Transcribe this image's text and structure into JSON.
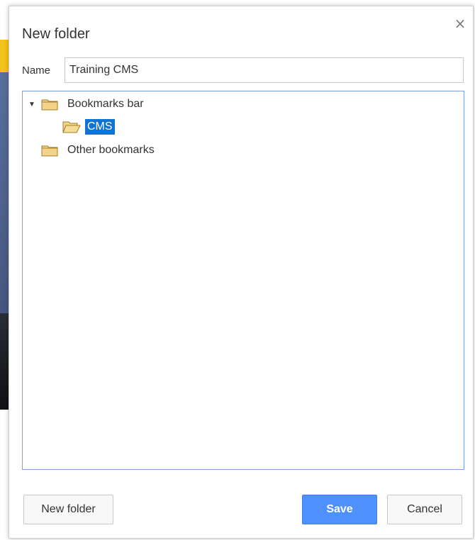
{
  "dialog": {
    "title": "New folder",
    "close_symbol": "×",
    "name_label": "Name",
    "name_value": "Training CMS"
  },
  "tree": {
    "items": [
      {
        "label": "Bookmarks bar",
        "icon": "folder-closed-icon",
        "expanded": true
      },
      {
        "label": "CMS",
        "icon": "folder-open-icon",
        "selected": true
      },
      {
        "label": "Other bookmarks",
        "icon": "folder-closed-icon"
      }
    ]
  },
  "buttons": {
    "new_folder": "New folder",
    "save": "Save",
    "cancel": "Cancel"
  },
  "colors": {
    "accent": "#4d90fe",
    "selection": "#0f73d4",
    "tree_border": "#7a9fdc",
    "folder": "#f3d38a"
  }
}
